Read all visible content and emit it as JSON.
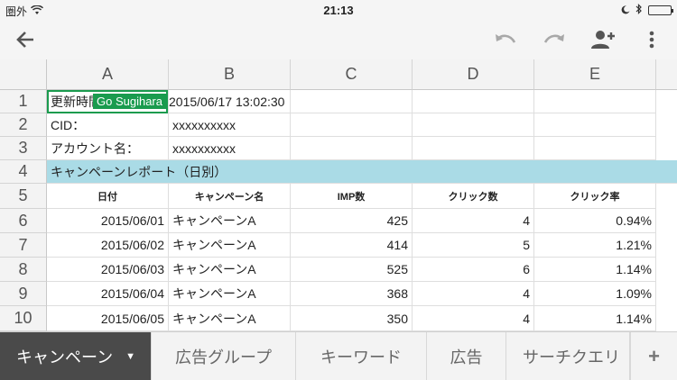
{
  "status": {
    "carrier": "圏外",
    "time": "21:13"
  },
  "columns": [
    "A",
    "B",
    "C",
    "D",
    "E"
  ],
  "rows": [
    "1",
    "2",
    "3",
    "4",
    "5",
    "6",
    "7",
    "8",
    "9",
    "10"
  ],
  "info": {
    "r1_label": "更新時間",
    "r1_value": "2015/06/17 13:02:30",
    "r2_label": "CID：",
    "r2_value": "xxxxxxxxxx",
    "r3_label": "アカウント名：",
    "r3_value": "xxxxxxxxxx"
  },
  "report_title": "キャンペーンレポート（日別）",
  "collaborator": "Go Sugihara",
  "table": {
    "headers": [
      "日付",
      "キャンペーン名",
      "IMP数",
      "クリック数",
      "クリック率"
    ],
    "rows": [
      [
        "2015/06/01",
        "キャンペーンA",
        "425",
        "4",
        "0.94%"
      ],
      [
        "2015/06/02",
        "キャンペーンA",
        "414",
        "5",
        "1.21%"
      ],
      [
        "2015/06/03",
        "キャンペーンA",
        "525",
        "6",
        "1.14%"
      ],
      [
        "2015/06/04",
        "キャンペーンA",
        "368",
        "4",
        "1.09%"
      ],
      [
        "2015/06/05",
        "キャンペーンA",
        "350",
        "4",
        "1.14%"
      ]
    ]
  },
  "sheet_tabs": [
    "キャンペーン",
    "広告グループ",
    "キーワード",
    "広告",
    "サーチクエリ"
  ],
  "add_sheet": "+",
  "colors": {
    "accent": "#1a9b4e",
    "band": "#aadbe6",
    "active_tab": "#4a4a4a"
  }
}
